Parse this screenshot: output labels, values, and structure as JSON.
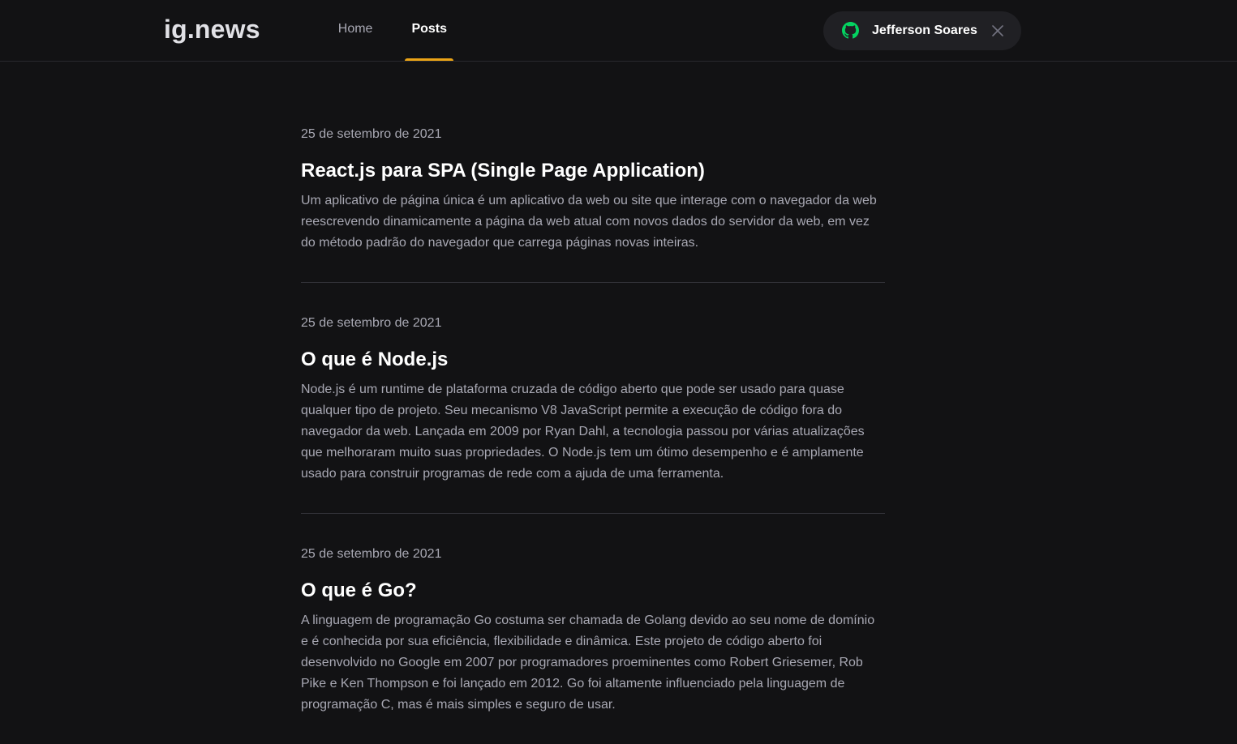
{
  "header": {
    "logo": "ig.news",
    "nav": [
      {
        "label": "Home",
        "active": false
      },
      {
        "label": "Posts",
        "active": true
      }
    ],
    "signin": {
      "user_name": "Jefferson Soares",
      "icon": "github-icon",
      "icon_color": "#04d361",
      "close_icon": "close-icon"
    }
  },
  "colors": {
    "background": "#121214",
    "accent": "#eba417",
    "text_primary": "#ffffff",
    "text_secondary": "#a8a8b3"
  },
  "posts": [
    {
      "date": "25 de setembro de 2021",
      "title": "React.js para SPA (Single Page Application)",
      "excerpt": "Um aplicativo de página única é um aplicativo da web ou site que interage com o navegador da web reescrevendo dinamicamente a página da web atual com novos dados do servidor da web, em vez do método padrão do navegador que carrega páginas novas inteiras."
    },
    {
      "date": "25 de setembro de 2021",
      "title": "O que é Node.js",
      "excerpt": "Node.js é um runtime de plataforma cruzada de código aberto que pode ser usado para quase qualquer tipo de projeto. Seu mecanismo V8 JavaScript permite a execução de código fora do navegador da web. Lançada em 2009 por Ryan Dahl, a tecnologia passou por várias atualizações que melhoraram muito suas propriedades. O Node.js tem um ótimo desempenho e é amplamente usado para construir programas de rede com a ajuda de uma ferramenta."
    },
    {
      "date": "25 de setembro de 2021",
      "title": "O que é Go?",
      "excerpt": "A linguagem de programação Go costuma ser chamada de Golang devido ao seu nome de domínio e é conhecida por sua eficiência, flexibilidade e dinâmica. Este projeto de código aberto foi desenvolvido no Google em 2007 por programadores proeminentes como Robert Griesemer, Rob Pike e Ken Thompson e foi lançado em 2012. Go foi altamente influenciado pela linguagem de programação C, mas é mais simples e seguro de usar."
    }
  ]
}
